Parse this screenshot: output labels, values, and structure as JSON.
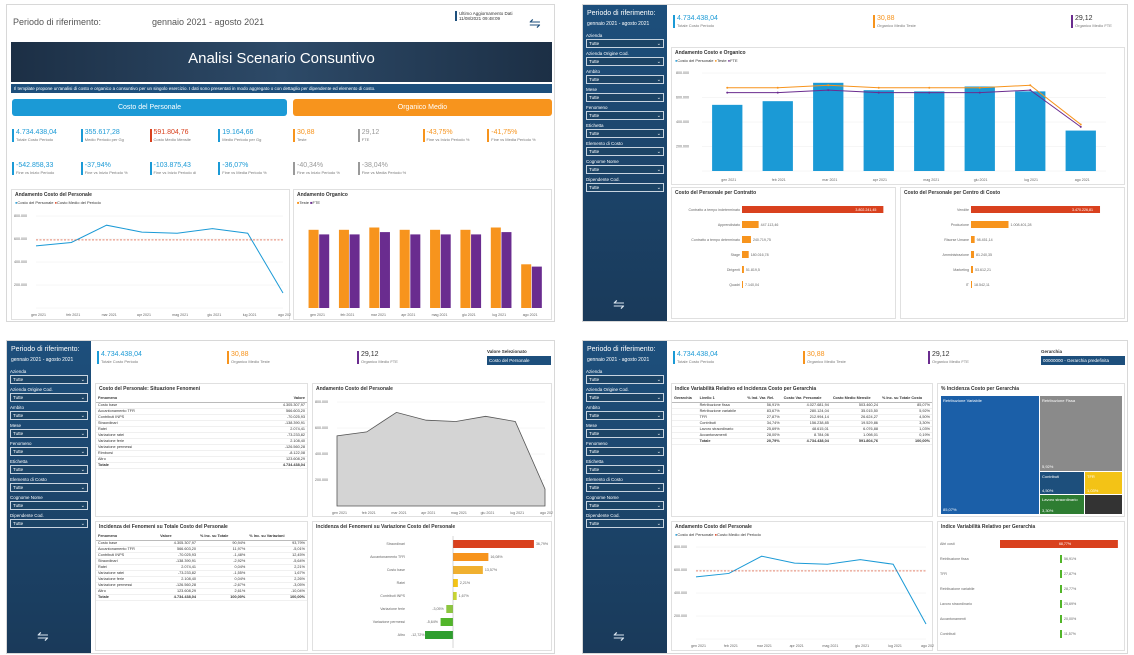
{
  "colors": {
    "blue": "#1b9ad6",
    "orange": "#f7941d",
    "purple": "#6a2c8f",
    "red": "#d9411e",
    "dark": "#1d4f7c",
    "green": "#52b52a",
    "gray": "#9a9a9a",
    "yellow": "#f3c316"
  },
  "p1": {
    "period_label": "Periodo di riferimento:",
    "period_value": "gennaio 2021 - agosto 2021",
    "update_label": "Ultimo Aggiornamento Dati",
    "update_value": "11/08/2021 09:48:09",
    "banner": "Analisi Scenario Consuntivo",
    "intro": "Il template propone un'analisi di costo e organico a consuntivo per un singolo esercizio. I dati sono presentati in modo aggregato o con dettaglio per dipendente ed elemento di costo.",
    "tab_costo": "Costo del Personale",
    "tab_organico": "Organico Medio",
    "kpis_costo": [
      {
        "v": "4.734.438,04",
        "l": "Totale Costo Periodo",
        "c": "blue"
      },
      {
        "v": "355.617,28",
        "l": "Medio Periodo per Gg",
        "c": "blue"
      },
      {
        "v": "591.804,76",
        "l": "Costo Medio Mensile",
        "c": "red"
      },
      {
        "v": "19.164,66",
        "l": "Medio Periodo per Gg",
        "c": "blue"
      },
      {
        "v": "-542.858,33",
        "l": "Fine vs Inizio Periodo",
        "c": "blue"
      },
      {
        "v": "-37,94%",
        "l": "Fine vs Inizio Periodo %",
        "c": "blue"
      },
      {
        "v": "-103.875,43",
        "l": "Fine vs Inizio Periodo di",
        "c": "blue"
      },
      {
        "v": "-36,07%",
        "l": "Fine vs Media Periodo %",
        "c": "blue"
      }
    ],
    "kpis_org": [
      {
        "v": "30,88",
        "l": "Teste",
        "c": "orange"
      },
      {
        "v": "29,12",
        "l": "FTE",
        "c": "gray"
      },
      {
        "v": "-43,75%",
        "l": "Fine vs Inizio Periodo %",
        "c": "orange"
      },
      {
        "v": "-41,75%",
        "l": "Fine vs Media Periodo %",
        "c": "orange"
      },
      {
        "v": "-40,34%",
        "l": "Fine vs Inizio Periodo %",
        "c": "gray"
      },
      {
        "v": "-38,04%",
        "l": "Fine vs Media Periodo %",
        "c": "gray"
      }
    ],
    "chart1_title": "Andamento Costo del Personale",
    "chart1_legend": [
      "Costo del Personale",
      "Costo Medio del Periodo"
    ],
    "chart2_title": "Andamento Organico",
    "chart2_legend": [
      "Teste",
      "FTE"
    ],
    "months": [
      "gen 2021",
      "feb 2021",
      "mar 2021",
      "apr 2021",
      "mag 2021",
      "giu 2021",
      "lug 2021",
      "ago 2021"
    ],
    "y1": [
      "800.000",
      "600.000",
      "400.000",
      "200.000"
    ]
  },
  "chart_data": [
    {
      "type": "line",
      "title": "Andamento Costo del Personale",
      "x": [
        "gen 2021",
        "feb 2021",
        "mar 2021",
        "apr 2021",
        "mag 2021",
        "giu 2021",
        "lug 2021",
        "ago 2021"
      ],
      "series": [
        {
          "name": "Costo del Personale",
          "values": [
            540000,
            570000,
            720000,
            660000,
            650000,
            690000,
            650000,
            130000
          ]
        },
        {
          "name": "Costo Medio del Periodo",
          "values": [
            591805,
            591805,
            591805,
            591805,
            591805,
            591805,
            591805,
            591805
          ]
        }
      ]
    },
    {
      "type": "bar",
      "title": "Andamento Organico",
      "categories": [
        "gen 2021",
        "feb 2021",
        "mar 2021",
        "apr 2021",
        "mag 2021",
        "giu 2021",
        "lug 2021",
        "ago 2021"
      ],
      "series": [
        {
          "name": "Teste",
          "values": [
            34,
            34,
            35,
            34,
            34,
            34,
            35,
            19
          ]
        },
        {
          "name": "FTE",
          "values": [
            32,
            32,
            33,
            32,
            32,
            32,
            33,
            18
          ]
        }
      ]
    },
    {
      "type": "bar",
      "title": "Andamento Costo e Organico",
      "categories": [
        "gen 2021",
        "feb 2021",
        "mar 2021",
        "apr 2021",
        "mag 2021",
        "giu 2021",
        "lug 2021",
        "ago 2021"
      ],
      "series": [
        {
          "name": "Costo del Personale",
          "values": [
            540000,
            570000,
            720000,
            660000,
            650000,
            690000,
            650000,
            330000
          ]
        },
        {
          "name": "Teste",
          "values": [
            34,
            34,
            35,
            34,
            34,
            34,
            35,
            19
          ]
        },
        {
          "name": "FTE",
          "values": [
            32,
            32,
            33,
            32,
            32,
            32,
            33,
            18
          ]
        }
      ]
    },
    {
      "type": "area",
      "title": "Andamento Costo del Personale",
      "x": [
        "gen 2021",
        "feb 2021",
        "mar 2021",
        "apr 2021",
        "mag 2021",
        "giu 2021",
        "lug 2021",
        "ago 2021"
      ],
      "series": [
        {
          "name": "Costo del Personale",
          "values": [
            540000,
            570000,
            720000,
            660000,
            650000,
            690000,
            650000,
            130000
          ]
        }
      ]
    }
  ],
  "p2": {
    "side_title": "Periodo di riferimento:",
    "side_period": "gennaio 2021 - agosto 2021",
    "filters": [
      "Azienda",
      "Azienda Origine Cod.",
      "Ambito",
      "Mese",
      "Fenomeno",
      "Etichetta",
      "Elemento di Costo",
      "Cognome Nome",
      "Dipendente Cod."
    ],
    "filter_value": "Tutte",
    "kpi_costo": "4.734.438,04",
    "kpi_costo_l": "Totale Costo Periodo",
    "kpi_teste": "30,88",
    "kpi_teste_l": "Organico Medio Teste",
    "kpi_fte": "29,12",
    "kpi_fte_l": "Organico Medio FTE",
    "chart_title": "Andamento Costo e Organico",
    "legend": [
      "Costo del Personale",
      "Teste",
      "FTE"
    ],
    "bar1_title": "Costo del Personale per Contratto",
    "bar1": [
      {
        "c": "Contratto a tempo indeterminato",
        "v": "3.802.241,45"
      },
      {
        "c": "Apprendistato",
        "v": "447.113,46"
      },
      {
        "c": "Contratto a tempo determinato",
        "v": "240.719,75"
      },
      {
        "c": "Stage",
        "v": "180.016,78"
      },
      {
        "c": "Dirigenti",
        "v": "51.819,5"
      },
      {
        "c": "Quadri",
        "v": "7.140,04"
      }
    ],
    "bar2_title": "Costo del Personale per Centro di Costo",
    "bar2": [
      {
        "c": "Vendite",
        "v": "3.470.226,81"
      },
      {
        "c": "Produzione",
        "v": "1.008.401,28"
      },
      {
        "c": "Risorse Umane",
        "v": "98.451,14"
      },
      {
        "c": "Amministrazione",
        "v": "81.240,35"
      },
      {
        "c": "Marketing",
        "v": "53.612,21"
      },
      {
        "c": "IT",
        "v": "18.542,11"
      }
    ]
  },
  "p3": {
    "side_title": "Periodo di riferimento:",
    "side_period": "gennaio 2021 - agosto 2021",
    "sel_label": "Valore Selezionato",
    "sel_value": "Costo del Personale",
    "tbl1_title": "Costo del Personale: Situazione Fenomeni",
    "tbl1_head": [
      "Fenomeno",
      "Valore"
    ],
    "tbl1": [
      [
        "Costo base",
        "4.305.307,97"
      ],
      [
        "Accantonamento TFR",
        "566.603,20"
      ],
      [
        "Contributi INPS",
        "-70.025,93"
      ],
      [
        "Straordinari",
        "-138.390,91"
      ],
      [
        "Ratei",
        "2.074,41"
      ],
      [
        "Variazione ratei",
        "-73.233,82"
      ],
      [
        "Variazione ferie",
        "2.108,40"
      ],
      [
        "Variazione permessi",
        "-126.560,28"
      ],
      [
        "Rimborsi",
        "-8.122,08"
      ],
      [
        "Altro",
        "123.608,29"
      ]
    ],
    "tbl1_total": [
      "Totale",
      "4.734.438,04"
    ],
    "area_title": "Andamento Costo del Personale",
    "tbl2_title": "Incidenza dei Fenomeni su Totale Costo del Personale",
    "tbl2_head": [
      "Fenomeno",
      "Valore",
      "% Inc. su Totale",
      "% Inc. su Variazioni"
    ],
    "tbl2": [
      [
        "Costo base",
        "4.305.307,97",
        "90,94%",
        "93,79%"
      ],
      [
        "Accantonamento TFR",
        "566.603,20",
        "11,97%",
        "-5,01%"
      ],
      [
        "Contributi INPS",
        "-70.025,93",
        "-1,48%",
        "12,45%"
      ],
      [
        "Straordinari",
        "-138.390,91",
        "-2,92%",
        "-5,64%"
      ],
      [
        "Ratei",
        "2.074,41",
        "0,04%",
        "2,21%"
      ],
      [
        "Variazione ratei",
        "-73.233,82",
        "-1,55%",
        "1,67%"
      ],
      [
        "Variazione ferie",
        "2.108,40",
        "0,04%",
        "2,26%"
      ],
      [
        "Variazione permessi",
        "-126.560,28",
        "-2,67%",
        "-3,05%"
      ],
      [
        "Altro",
        "123.608,29",
        "2,61%",
        "-10,04%"
      ]
    ],
    "tbl2_total": [
      "Totale",
      "4.734.438,04",
      "100,00%",
      "100,00%"
    ],
    "inc_title": "Incidenza dei Fenomeni su Variazione Costo del Personale",
    "inc": [
      {
        "c": "Straordinari",
        "v": "36,79%"
      },
      {
        "c": "Accantonamento TFR",
        "v": "16,08%"
      },
      {
        "c": "Costo base",
        "v": "13,57%"
      },
      {
        "c": "Ratei",
        "v": "2,21%"
      },
      {
        "c": "Contributi INPS",
        "v": "1,67%"
      },
      {
        "c": "Variazione ferie",
        "v": "-3,05%"
      },
      {
        "c": "Variazione permessi",
        "v": "-5,64%"
      },
      {
        "c": "Altro",
        "v": "-12,72%"
      }
    ]
  },
  "p4": {
    "side_title": "Periodo di riferimento:",
    "side_period": "gennaio 2021 - agosto 2021",
    "sel_label": "Gerarchia",
    "sel_value": "00000000 - Gerarchia predefinita",
    "tbl_title": "Indice Variabilità Relativo ed Incidenza Costo per Gerarchia",
    "tbl_head": [
      "Gerarchia",
      "Livello 1",
      "% Ind. Var. Rel.",
      "Costo Var. Personale",
      "Costo Medio Mensile",
      "% Inc. su Totale Costo"
    ],
    "tbl": [
      [
        "Retribuzione fissa",
        "56,91%",
        "4.027.681,94",
        "503.460,24",
        "85,07%"
      ],
      [
        "Retribuzione variabile",
        "83,67%",
        "280.124,04",
        "35.015,50",
        "5,92%"
      ],
      [
        "TFR",
        "27,87%",
        "212.994,14",
        "26.624,27",
        "4,50%"
      ],
      [
        "Contributi",
        "34,74%",
        "156.238,85",
        "19.529,86",
        "3,30%"
      ],
      [
        "Lavoro straordinario",
        "25,69%",
        "48.615,01",
        "6.076,88",
        "1,03%"
      ],
      [
        "Accantonamenti",
        "28,00%",
        "8.784,06",
        "1.098,01",
        "0,19%"
      ]
    ],
    "tbl_total": [
      "Totale",
      "20,79%",
      "4.734.438,04",
      "591.804,76",
      "100,00%"
    ],
    "tree_title": "% Incidenza Costo per Gerarchia",
    "tree": [
      {
        "l": "Retribuzione Variabile",
        "p": "85,07%"
      },
      {
        "l": "Retribuzione Fissa",
        "p": "5,92%"
      },
      {
        "l": "Contributi",
        "p": "4,50%"
      },
      {
        "l": "Lavoro straordinario",
        "p": "3,30%"
      },
      {
        "l": "TFR",
        "p": "1,03%"
      }
    ],
    "line_title": "Andamento Costo del Personale",
    "line_legend": [
      "Costo del Personale",
      "Costo Medio del Periodo"
    ],
    "var_title": "Indice Variabilità Relativo per Gerarchia",
    "var": [
      {
        "c": "Altri costi",
        "v": "68,77%"
      },
      {
        "c": "Retribuzione fissa",
        "v": "56,91%"
      },
      {
        "c": "TFR",
        "v": "27,87%"
      },
      {
        "c": "Retribuzione variabile",
        "v": "28,77%"
      },
      {
        "c": "Lavoro straordinario",
        "v": "25,69%"
      },
      {
        "c": "Accantonamenti",
        "v": "20,00%"
      },
      {
        "c": "Contributi",
        "v": "11,57%"
      }
    ]
  }
}
